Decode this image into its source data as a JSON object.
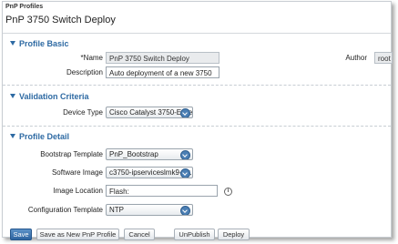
{
  "breadcrumb": "PnP Profiles",
  "title": "PnP 3750 Switch Deploy",
  "sections": {
    "basic": "Profile Basic",
    "validation": "Validation Criteria",
    "detail": "Profile Detail"
  },
  "basic": {
    "name_label": "*Name",
    "name_value": "PnP 3750 Switch Deploy",
    "description_label": "Description",
    "description_value": "Auto deployment of a new 3750",
    "author_label": "Author",
    "author_value": "root"
  },
  "validation": {
    "device_type_label": "Device Type",
    "device_type_value": "Cisco Catalyst 3750-E Seri..."
  },
  "detail": {
    "bootstrap_label": "Bootstrap Template",
    "bootstrap_value": "PnP_Bootstrap",
    "software_label": "Software Image",
    "software_value": "c3750-ipserviceslmk9-tar....",
    "location_label": "Image Location",
    "location_value": "Flash:",
    "config_label": "Configuration Template",
    "config_value": "NTP",
    "info_glyph": "i"
  },
  "buttons": {
    "save": "Save",
    "save_as": "Save as New PnP Profile",
    "cancel": "Cancel",
    "unpublish": "UnPublish",
    "deploy": "Deploy"
  }
}
